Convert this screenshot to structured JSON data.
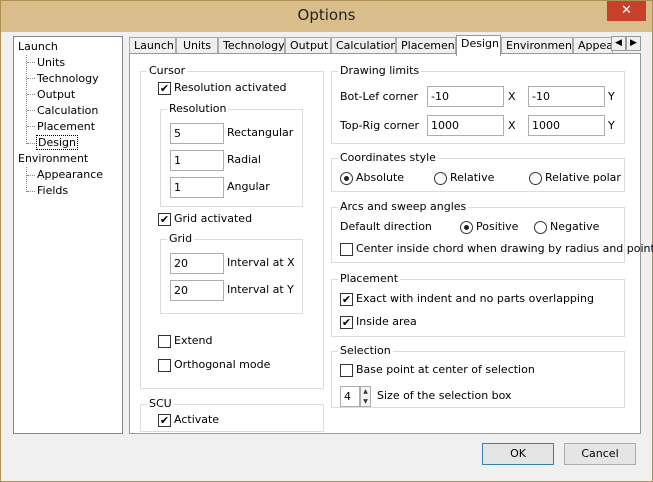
{
  "window": {
    "title": "Options",
    "close": "✕"
  },
  "tree": {
    "items": [
      {
        "label": "Launch"
      },
      {
        "label": "Units"
      },
      {
        "label": "Technology"
      },
      {
        "label": "Output"
      },
      {
        "label": "Calculation"
      },
      {
        "label": "Placement"
      },
      {
        "label": "Design"
      },
      {
        "label": "Environment"
      },
      {
        "label": "Appearance"
      },
      {
        "label": "Fields"
      }
    ]
  },
  "tabs": [
    {
      "label": "Launch"
    },
    {
      "label": "Units"
    },
    {
      "label": "Technology"
    },
    {
      "label": "Output"
    },
    {
      "label": "Calculation"
    },
    {
      "label": "Placement"
    },
    {
      "label": "Design"
    },
    {
      "label": "Environment"
    },
    {
      "label": "Appea"
    }
  ],
  "tab_scroll": {
    "left": "◀",
    "right": "▶"
  },
  "cursor": {
    "title": "Cursor",
    "resolution_activated": "Resolution activated",
    "resolution": {
      "title": "Resolution",
      "rectangular_value": "5",
      "rectangular_label": "Rectangular",
      "radial_value": "1",
      "radial_label": "Radial",
      "angular_value": "1",
      "angular_label": "Angular"
    },
    "grid_activated": "Grid activated",
    "grid": {
      "title": "Grid",
      "interval_x_value": "20",
      "interval_x_label": "Interval at X",
      "interval_y_value": "20",
      "interval_y_label": "Interval at Y"
    },
    "extend": "Extend",
    "orthogonal": "Orthogonal mode"
  },
  "scu": {
    "title": "SCU",
    "activate": "Activate"
  },
  "drawing_limits": {
    "title": "Drawing limits",
    "bot_label": "Bot-Lef corner",
    "bot_x": "-10",
    "bot_y": "-10",
    "top_label": "Top-Rig corner",
    "top_x": "1000",
    "top_y": "1000",
    "x": "X",
    "y": "Y"
  },
  "coordinates": {
    "title": "Coordinates style",
    "absolute": "Absolute",
    "relative": "Relative",
    "relative_polar": "Relative polar"
  },
  "arcs": {
    "title": "Arcs and sweep angles",
    "default_direction": "Default direction",
    "positive": "Positive",
    "negative": "Negative",
    "center_inside": "Center inside chord when drawing by radius and point"
  },
  "placement": {
    "title": "Placement",
    "exact": "Exact with indent and no parts overlapping",
    "inside": "Inside area"
  },
  "selection": {
    "title": "Selection",
    "base_point": "Base point at center of selection",
    "size_value": "4",
    "size_label": "Size of the selection box"
  },
  "buttons": {
    "ok": "OK",
    "cancel": "Cancel"
  },
  "check": "✔",
  "colors": {
    "titlebar": "#d9bd8b",
    "close": "#c7402a"
  }
}
